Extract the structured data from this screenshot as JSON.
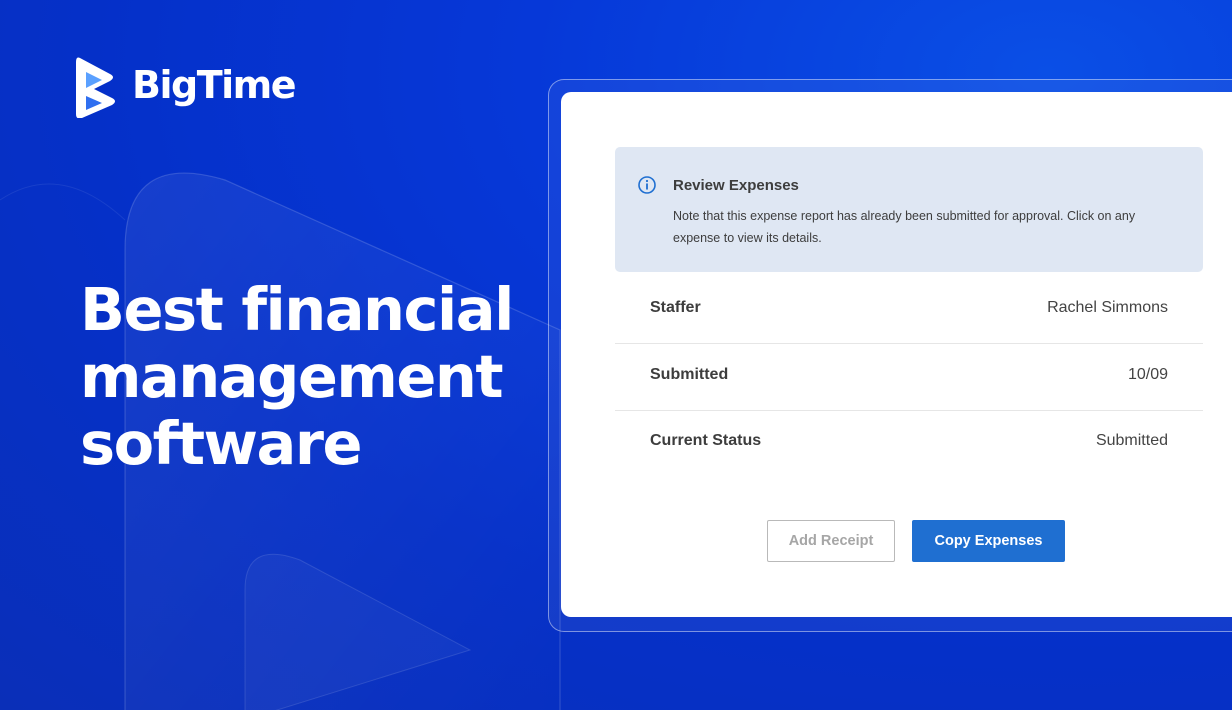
{
  "brand": {
    "name": "BigTime"
  },
  "hero": {
    "headline_lines": [
      "Best financial",
      "management",
      "software"
    ]
  },
  "notice": {
    "title": "Review Expenses",
    "message": "Note that this expense report has already been submitted for approval. Click on any expense to view its details."
  },
  "details": [
    {
      "label": "Staffer",
      "value": "Rachel Simmons"
    },
    {
      "label": "Submitted",
      "value": "10/09"
    },
    {
      "label": "Current Status",
      "value": "Submitted"
    }
  ],
  "actions": {
    "add_receipt": "Add Receipt",
    "copy_expenses": "Copy Expenses"
  },
  "colors": {
    "background": "#0638d8",
    "accent": "#1f6fd1",
    "notice_bg": "#dfe7f3"
  }
}
